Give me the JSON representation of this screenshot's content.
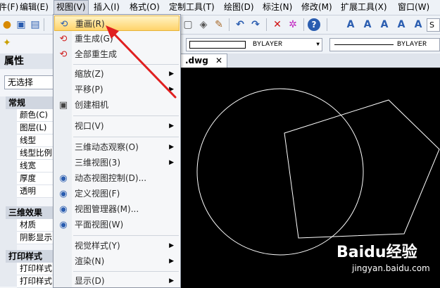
{
  "menubar": {
    "items": [
      {
        "label": "件(F)"
      },
      {
        "label": "编辑(E)"
      },
      {
        "label": "视图(V)"
      },
      {
        "label": "插入(I)"
      },
      {
        "label": "格式(O)"
      },
      {
        "label": "定制工具(T)"
      },
      {
        "label": "绘图(D)"
      },
      {
        "label": "标注(N)"
      },
      {
        "label": "修改(M)"
      },
      {
        "label": "扩展工具(X)"
      },
      {
        "label": "窗口(W)"
      }
    ]
  },
  "layerbar": {
    "color_value": "BYLAYER",
    "linetype_value": "BYLAYER",
    "style_value": "S"
  },
  "left_panel": {
    "title": "属性",
    "selection": "无选择",
    "sections": [
      {
        "header": "常规",
        "rows": [
          "颜色(C)",
          "图层(L)",
          "线型",
          "线型比例",
          "线宽",
          "厚度",
          "透明"
        ]
      },
      {
        "header": "三维效果",
        "rows": [
          "材质",
          "阴影显示"
        ]
      },
      {
        "header": "打印样式",
        "rows": [
          "打印样式",
          "打印样式"
        ]
      }
    ]
  },
  "view_menu": {
    "items": [
      {
        "label": "重画(R)",
        "icon": "redraw-icon",
        "highlighted": true
      },
      {
        "label": "重生成(G)",
        "icon": "regen-icon"
      },
      {
        "label": "全部重生成",
        "icon": "regen-all-icon"
      },
      {
        "label": "缩放(Z)",
        "submenu": true
      },
      {
        "label": "平移(P)",
        "submenu": true
      },
      {
        "label": "创建相机",
        "icon": "camera-icon"
      },
      {
        "label": "视口(V)",
        "submenu": true
      },
      {
        "label": "三维动态观察(O)",
        "submenu": true
      },
      {
        "label": "三维视图(3)",
        "submenu": true
      },
      {
        "label": "动态视图控制(D)...",
        "icon": "dynamic-view-icon"
      },
      {
        "label": "定义视图(F)",
        "icon": "define-view-icon"
      },
      {
        "label": "视图管理器(M)...",
        "icon": "view-manager-icon"
      },
      {
        "label": "平面视图(W)",
        "icon": "plan-view-icon"
      },
      {
        "label": "视觉样式(Y)",
        "submenu": true
      },
      {
        "label": "渲染(N)",
        "submenu": true
      },
      {
        "label": "显示(D)",
        "submenu": true
      }
    ]
  },
  "document": {
    "tab_label": ".dwg"
  },
  "watermark": {
    "brand": "Baidu经验",
    "url": "jingyan.baidu.com"
  },
  "colors": {
    "highlight": "#ffd36a",
    "canvas_bg": "#000000",
    "annotation_arrow": "#e02020"
  }
}
